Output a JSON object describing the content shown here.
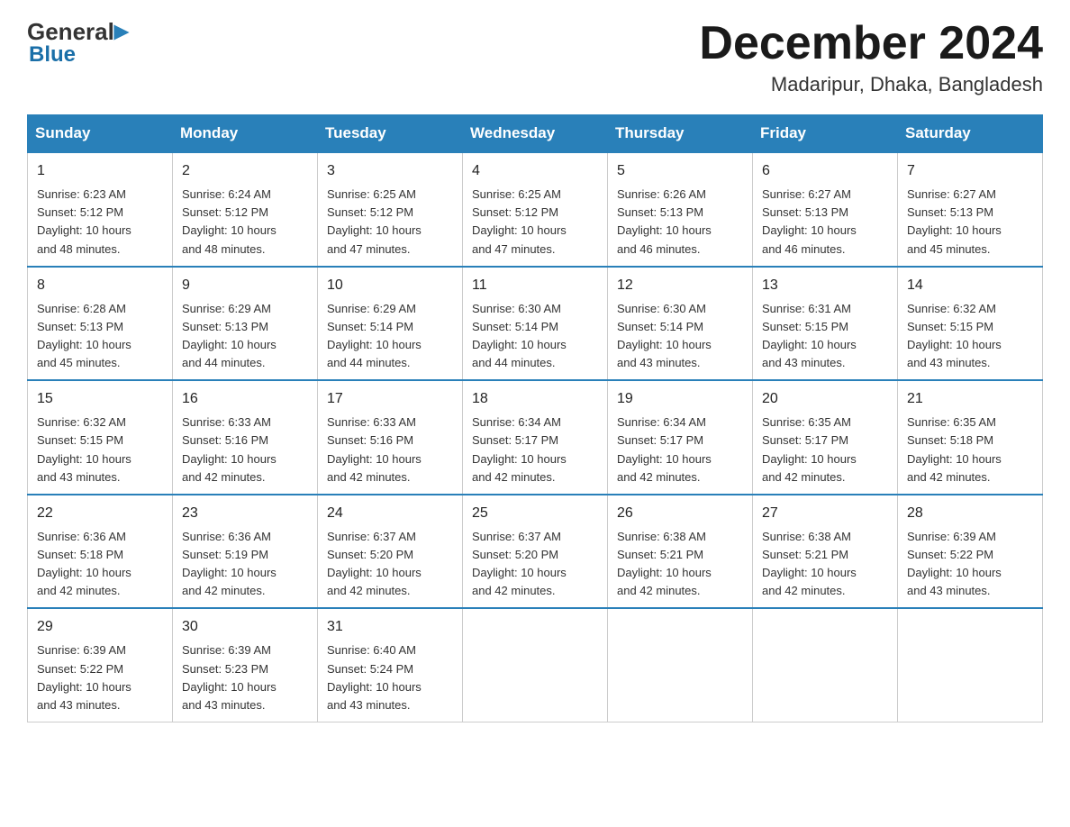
{
  "header": {
    "logo_general": "General",
    "logo_blue": "Blue",
    "title": "December 2024",
    "location": "Madaripur, Dhaka, Bangladesh"
  },
  "days_of_week": [
    "Sunday",
    "Monday",
    "Tuesday",
    "Wednesday",
    "Thursday",
    "Friday",
    "Saturday"
  ],
  "weeks": [
    [
      {
        "day": "1",
        "sunrise": "6:23 AM",
        "sunset": "5:12 PM",
        "daylight": "10 hours and 48 minutes."
      },
      {
        "day": "2",
        "sunrise": "6:24 AM",
        "sunset": "5:12 PM",
        "daylight": "10 hours and 48 minutes."
      },
      {
        "day": "3",
        "sunrise": "6:25 AM",
        "sunset": "5:12 PM",
        "daylight": "10 hours and 47 minutes."
      },
      {
        "day": "4",
        "sunrise": "6:25 AM",
        "sunset": "5:12 PM",
        "daylight": "10 hours and 47 minutes."
      },
      {
        "day": "5",
        "sunrise": "6:26 AM",
        "sunset": "5:13 PM",
        "daylight": "10 hours and 46 minutes."
      },
      {
        "day": "6",
        "sunrise": "6:27 AM",
        "sunset": "5:13 PM",
        "daylight": "10 hours and 46 minutes."
      },
      {
        "day": "7",
        "sunrise": "6:27 AM",
        "sunset": "5:13 PM",
        "daylight": "10 hours and 45 minutes."
      }
    ],
    [
      {
        "day": "8",
        "sunrise": "6:28 AM",
        "sunset": "5:13 PM",
        "daylight": "10 hours and 45 minutes."
      },
      {
        "day": "9",
        "sunrise": "6:29 AM",
        "sunset": "5:13 PM",
        "daylight": "10 hours and 44 minutes."
      },
      {
        "day": "10",
        "sunrise": "6:29 AM",
        "sunset": "5:14 PM",
        "daylight": "10 hours and 44 minutes."
      },
      {
        "day": "11",
        "sunrise": "6:30 AM",
        "sunset": "5:14 PM",
        "daylight": "10 hours and 44 minutes."
      },
      {
        "day": "12",
        "sunrise": "6:30 AM",
        "sunset": "5:14 PM",
        "daylight": "10 hours and 43 minutes."
      },
      {
        "day": "13",
        "sunrise": "6:31 AM",
        "sunset": "5:15 PM",
        "daylight": "10 hours and 43 minutes."
      },
      {
        "day": "14",
        "sunrise": "6:32 AM",
        "sunset": "5:15 PM",
        "daylight": "10 hours and 43 minutes."
      }
    ],
    [
      {
        "day": "15",
        "sunrise": "6:32 AM",
        "sunset": "5:15 PM",
        "daylight": "10 hours and 43 minutes."
      },
      {
        "day": "16",
        "sunrise": "6:33 AM",
        "sunset": "5:16 PM",
        "daylight": "10 hours and 42 minutes."
      },
      {
        "day": "17",
        "sunrise": "6:33 AM",
        "sunset": "5:16 PM",
        "daylight": "10 hours and 42 minutes."
      },
      {
        "day": "18",
        "sunrise": "6:34 AM",
        "sunset": "5:17 PM",
        "daylight": "10 hours and 42 minutes."
      },
      {
        "day": "19",
        "sunrise": "6:34 AM",
        "sunset": "5:17 PM",
        "daylight": "10 hours and 42 minutes."
      },
      {
        "day": "20",
        "sunrise": "6:35 AM",
        "sunset": "5:17 PM",
        "daylight": "10 hours and 42 minutes."
      },
      {
        "day": "21",
        "sunrise": "6:35 AM",
        "sunset": "5:18 PM",
        "daylight": "10 hours and 42 minutes."
      }
    ],
    [
      {
        "day": "22",
        "sunrise": "6:36 AM",
        "sunset": "5:18 PM",
        "daylight": "10 hours and 42 minutes."
      },
      {
        "day": "23",
        "sunrise": "6:36 AM",
        "sunset": "5:19 PM",
        "daylight": "10 hours and 42 minutes."
      },
      {
        "day": "24",
        "sunrise": "6:37 AM",
        "sunset": "5:20 PM",
        "daylight": "10 hours and 42 minutes."
      },
      {
        "day": "25",
        "sunrise": "6:37 AM",
        "sunset": "5:20 PM",
        "daylight": "10 hours and 42 minutes."
      },
      {
        "day": "26",
        "sunrise": "6:38 AM",
        "sunset": "5:21 PM",
        "daylight": "10 hours and 42 minutes."
      },
      {
        "day": "27",
        "sunrise": "6:38 AM",
        "sunset": "5:21 PM",
        "daylight": "10 hours and 42 minutes."
      },
      {
        "day": "28",
        "sunrise": "6:39 AM",
        "sunset": "5:22 PM",
        "daylight": "10 hours and 43 minutes."
      }
    ],
    [
      {
        "day": "29",
        "sunrise": "6:39 AM",
        "sunset": "5:22 PM",
        "daylight": "10 hours and 43 minutes."
      },
      {
        "day": "30",
        "sunrise": "6:39 AM",
        "sunset": "5:23 PM",
        "daylight": "10 hours and 43 minutes."
      },
      {
        "day": "31",
        "sunrise": "6:40 AM",
        "sunset": "5:24 PM",
        "daylight": "10 hours and 43 minutes."
      },
      null,
      null,
      null,
      null
    ]
  ],
  "labels": {
    "sunrise": "Sunrise:",
    "sunset": "Sunset:",
    "daylight": "Daylight:"
  }
}
